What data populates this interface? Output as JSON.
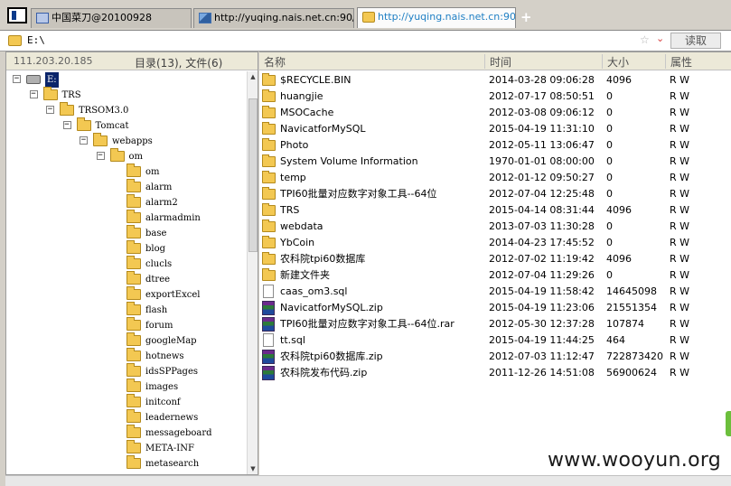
{
  "tabs": [
    {
      "label": "中国菜刀@20100928",
      "icon": "page-icon",
      "active": false
    },
    {
      "label": "http://yuqing.nais.net.cn:90/...",
      "icon": "image-icon",
      "active": false
    },
    {
      "label": "http://yuqing.nais.net.cn:90/...",
      "icon": "folder-icon",
      "active": true
    }
  ],
  "new_tab_label": "+",
  "address": {
    "path": "E:\\",
    "star": "☆",
    "dropdown": "⌄",
    "read_label": "读取"
  },
  "left": {
    "ip": "111.203.20.185",
    "counts": "目录(13), 文件(6)",
    "tree": [
      {
        "label": "E:",
        "type": "drive",
        "expanded": true,
        "selected": true
      },
      {
        "label": "TRS",
        "type": "folder",
        "expanded": true
      },
      {
        "label": "TRSOM3.0",
        "type": "folder",
        "expanded": true
      },
      {
        "label": "Tomcat",
        "type": "folder",
        "expanded": true
      },
      {
        "label": "webapps",
        "type": "folder",
        "expanded": true
      },
      {
        "label": "om",
        "type": "folder",
        "expanded": true
      },
      {
        "label": "om",
        "type": "folder"
      },
      {
        "label": "alarm",
        "type": "folder"
      },
      {
        "label": "alarm2",
        "type": "folder"
      },
      {
        "label": "alarmadmin",
        "type": "folder"
      },
      {
        "label": "base",
        "type": "folder"
      },
      {
        "label": "blog",
        "type": "folder"
      },
      {
        "label": "clucls",
        "type": "folder"
      },
      {
        "label": "dtree",
        "type": "folder"
      },
      {
        "label": "exportExcel",
        "type": "folder"
      },
      {
        "label": "flash",
        "type": "folder"
      },
      {
        "label": "forum",
        "type": "folder"
      },
      {
        "label": "googleMap",
        "type": "folder"
      },
      {
        "label": "hotnews",
        "type": "folder"
      },
      {
        "label": "idsSPPages",
        "type": "folder"
      },
      {
        "label": "images",
        "type": "folder"
      },
      {
        "label": "initconf",
        "type": "folder"
      },
      {
        "label": "leadernews",
        "type": "folder"
      },
      {
        "label": "messageboard",
        "type": "folder"
      },
      {
        "label": "META-INF",
        "type": "folder"
      },
      {
        "label": "metasearch",
        "type": "folder"
      }
    ]
  },
  "columns": {
    "name": "名称",
    "time": "时间",
    "size": "大小",
    "attr": "属性"
  },
  "files": [
    {
      "name": "$RECYCLE.BIN",
      "time": "2014-03-28 09:06:28",
      "size": "4096",
      "attr": "R W",
      "type": "folder"
    },
    {
      "name": "huangjie",
      "time": "2012-07-17 08:50:51",
      "size": "0",
      "attr": "R W",
      "type": "folder"
    },
    {
      "name": "MSOCache",
      "time": "2012-03-08 09:06:12",
      "size": "0",
      "attr": "R W",
      "type": "folder"
    },
    {
      "name": "NavicatforMySQL",
      "time": "2015-04-19 11:31:10",
      "size": "0",
      "attr": "R W",
      "type": "folder"
    },
    {
      "name": "Photo",
      "time": "2012-05-11 13:06:47",
      "size": "0",
      "attr": "R W",
      "type": "folder"
    },
    {
      "name": "System Volume Information",
      "time": "1970-01-01 08:00:00",
      "size": "0",
      "attr": "R W",
      "type": "folder"
    },
    {
      "name": "temp",
      "time": "2012-01-12 09:50:27",
      "size": "0",
      "attr": "R W",
      "type": "folder"
    },
    {
      "name": "TPI60批量对应数字对象工具--64位",
      "time": "2012-07-04 12:25:48",
      "size": "0",
      "attr": "R W",
      "type": "folder"
    },
    {
      "name": "TRS",
      "time": "2015-04-14 08:31:44",
      "size": "4096",
      "attr": "R W",
      "type": "folder"
    },
    {
      "name": "webdata",
      "time": "2013-07-03 11:30:28",
      "size": "0",
      "attr": "R W",
      "type": "folder"
    },
    {
      "name": "YbCoin",
      "time": "2014-04-23 17:45:52",
      "size": "0",
      "attr": "R W",
      "type": "folder"
    },
    {
      "name": "农科院tpi60数据库",
      "time": "2012-07-02 11:19:42",
      "size": "4096",
      "attr": "R W",
      "type": "folder"
    },
    {
      "name": "新建文件夹",
      "time": "2012-07-04 11:29:26",
      "size": "0",
      "attr": "R W",
      "type": "folder"
    },
    {
      "name": "caas_om3.sql",
      "time": "2015-04-19 11:58:42",
      "size": "14645098",
      "attr": "R W",
      "type": "sql"
    },
    {
      "name": "NavicatforMySQL.zip",
      "time": "2015-04-19 11:23:06",
      "size": "21551354",
      "attr": "R W",
      "type": "zip"
    },
    {
      "name": "TPI60批量对应数字对象工具--64位.rar",
      "time": "2012-05-30 12:37:28",
      "size": "107874",
      "attr": "R W",
      "type": "zip"
    },
    {
      "name": "tt.sql",
      "time": "2015-04-19 11:44:25",
      "size": "464",
      "attr": "R W",
      "type": "sql"
    },
    {
      "name": "农科院tpi60数据库.zip",
      "time": "2012-07-03 11:12:47",
      "size": "722873420",
      "attr": "R W",
      "type": "zip"
    },
    {
      "name": "农科院发布代码.zip",
      "time": "2011-12-26 14:51:08",
      "size": "56900624",
      "attr": "R W",
      "type": "zip"
    }
  ],
  "watermark": "www.wooyun.org"
}
